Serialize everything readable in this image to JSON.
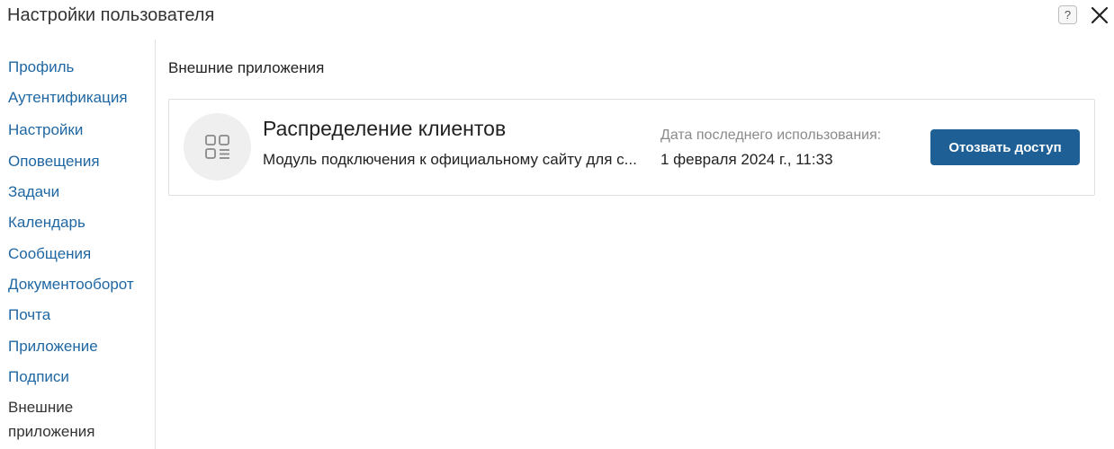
{
  "window": {
    "title": "Настройки пользователя",
    "help_icon": "question-icon",
    "help_label": "?",
    "close_icon": "close-icon"
  },
  "sidebar": {
    "items": [
      {
        "label": "Профиль",
        "active": false
      },
      {
        "label": "Аутентификация",
        "active": false
      },
      {
        "label": "Настройки",
        "active": false
      },
      {
        "label": "Оповещения",
        "active": false
      },
      {
        "label": "Задачи",
        "active": false
      },
      {
        "label": "Календарь",
        "active": false
      },
      {
        "label": "Сообщения",
        "active": false
      },
      {
        "label": "Документооборот",
        "active": false
      },
      {
        "label": "Почта",
        "active": false
      },
      {
        "label": "Приложение",
        "active": false
      },
      {
        "label": "Подписи",
        "active": false
      },
      {
        "label": "Внешние приложения",
        "active": true
      }
    ]
  },
  "main": {
    "section_title": "Внешние приложения",
    "apps": [
      {
        "icon": "app-grid-icon",
        "name": "Распределение клиентов",
        "description": "Модуль подключения к официальному сайту для с...",
        "last_used_label": "Дата последнего использования:",
        "last_used_value": "1 февраля 2024 г., 11:33",
        "revoke_label": "Отозвать доступ"
      }
    ]
  },
  "colors": {
    "link": "#1f67a3",
    "primary_button": "#1e6096",
    "muted_text": "#8a8a8a",
    "border": "#e0e0e0",
    "avatar_bg": "#efefef"
  }
}
